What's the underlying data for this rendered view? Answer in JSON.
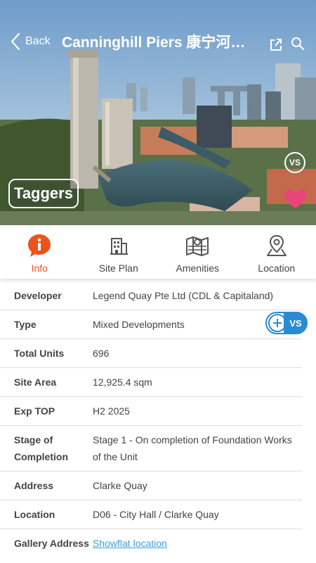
{
  "header": {
    "back_label": "Back",
    "title": "Canninghill Piers 康宁河…"
  },
  "hero": {
    "taggers_label": "Taggers",
    "vs_label": "VS",
    "icons": [
      "share-icon",
      "search-icon",
      "heart-icon",
      "vs-icon"
    ]
  },
  "tabs": [
    {
      "label": "Info",
      "icon": "info-icon",
      "active": true
    },
    {
      "label": "Site Plan",
      "icon": "building-icon",
      "active": false
    },
    {
      "label": "Amenities",
      "icon": "map-icon",
      "active": false
    },
    {
      "label": "Location",
      "icon": "location-pin-icon",
      "active": false
    }
  ],
  "compare_button": {
    "label": "VS"
  },
  "info_rows": [
    {
      "key": "Developer",
      "value": "Legend Quay Pte Ltd (CDL & Capitaland)"
    },
    {
      "key": "Type",
      "value": "Mixed Developments"
    },
    {
      "key": "Total Units",
      "value": "696"
    },
    {
      "key": "Site Area",
      "value": "12,925.4 sqm"
    },
    {
      "key": "Exp TOP",
      "value": "H2 2025"
    },
    {
      "key": "Stage of Completion",
      "value": "Stage 1 - On completion of Foundation Works of the Unit"
    },
    {
      "key": "Address",
      "value": "Clarke Quay"
    },
    {
      "key": "Location",
      "value": "D06 - City Hall / Clarke Quay"
    },
    {
      "key": "Gallery Address",
      "value": "Showflat location"
    }
  ],
  "colors": {
    "accent": "#e8541c",
    "link": "#3aa0dd",
    "vs_blue": "#2a8bd2",
    "heart": "#e8457a"
  }
}
